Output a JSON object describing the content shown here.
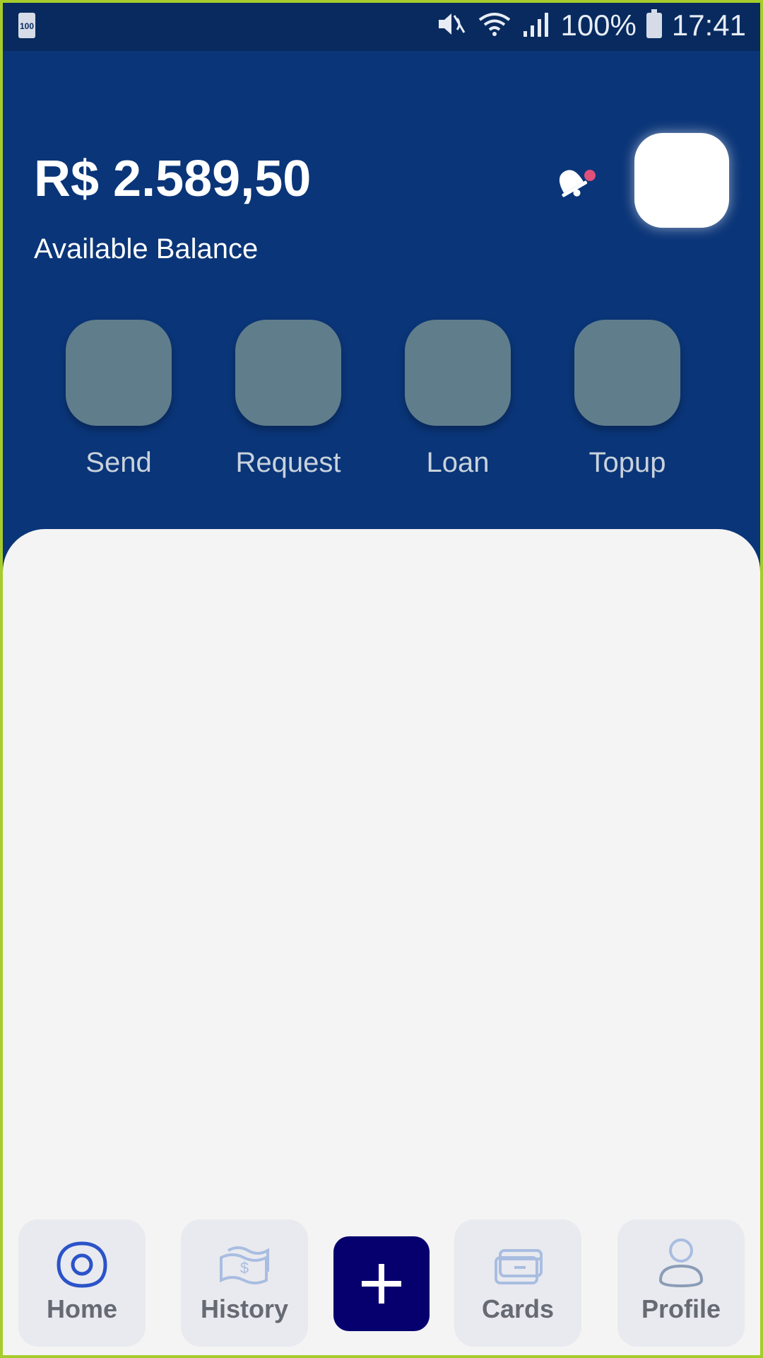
{
  "status_bar": {
    "battery_badge": "100",
    "battery_percent": "100%",
    "time": "17:41",
    "icons": [
      "mute-icon",
      "wifi-icon",
      "signal-icon",
      "battery-icon"
    ]
  },
  "header": {
    "balance": "R$ 2.589,50",
    "balance_label": "Available Balance",
    "bell_icon": "bell-icon",
    "notification_dot_color": "#e0507a"
  },
  "quick_actions": [
    {
      "label": "Send"
    },
    {
      "label": "Request"
    },
    {
      "label": "Loan"
    },
    {
      "label": "Topup"
    }
  ],
  "bottom_nav": {
    "items": [
      {
        "label": "Home",
        "icon": "home-icon",
        "active": true
      },
      {
        "label": "History",
        "icon": "money-icon",
        "active": false
      },
      {
        "label": "Cards",
        "icon": "card-icon",
        "active": false
      },
      {
        "label": "Profile",
        "icon": "profile-icon",
        "active": false
      }
    ],
    "fab_icon": "plus-icon"
  },
  "colors": {
    "header_bg": "#0a3578",
    "status_bg": "#082a5e",
    "action_tile": "#607d8b",
    "content_bg": "#f4f4f4",
    "fab_bg": "#06006e"
  }
}
